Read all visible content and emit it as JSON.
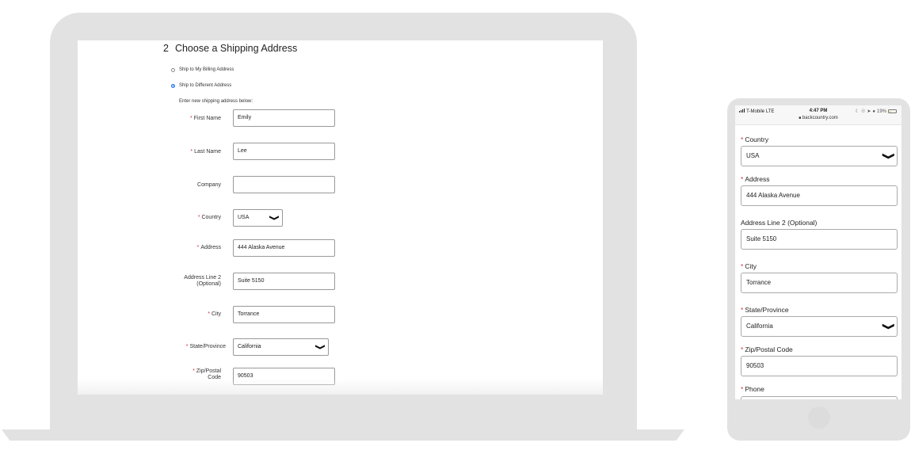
{
  "desktop": {
    "section_step": "2",
    "section_title": "Choose a Shipping Address",
    "shipping_options": [
      {
        "label": "Ship to My Billing Address",
        "checked": false
      },
      {
        "label": "Ship to Different Address",
        "checked": true
      }
    ],
    "hint": "Enter new shipping address below:",
    "required_marker": "*",
    "fields": {
      "first_name": {
        "label": "First Name",
        "value": "Emily",
        "required": true
      },
      "last_name": {
        "label": "Last Name",
        "value": "Lee",
        "required": true
      },
      "company": {
        "label": "Company",
        "value": "",
        "required": false
      },
      "country": {
        "label": "Country",
        "value": "USA",
        "required": true
      },
      "address": {
        "label": "Address",
        "value": "444 Alaska Avenue",
        "required": true
      },
      "address2": {
        "label_line1": "Address Line 2",
        "label_line2": "(Optional)",
        "value": "Suite 5150",
        "required": false
      },
      "city": {
        "label": "City",
        "value": "Torrance",
        "required": true
      },
      "state": {
        "label": "State/Province",
        "value": "California",
        "required": true
      },
      "zip": {
        "label_line1": "Zip/Postal",
        "label_line2": "Code",
        "value": "90503",
        "required": true
      }
    }
  },
  "mobile": {
    "status_bar": {
      "carrier": "T-Mobile  LTE",
      "time": "4:47 PM",
      "url": "backcountry.com",
      "battery": "19%",
      "battery_level": 0.19
    },
    "required_marker": "*",
    "fields": {
      "country": {
        "label": "Country",
        "value": "USA"
      },
      "address": {
        "label": "Address",
        "value": "444 Alaska Avenue"
      },
      "address2": {
        "label": "Address Line 2 (Optional)",
        "value": "Suite 5150"
      },
      "city": {
        "label": "City",
        "value": "Torrance"
      },
      "state": {
        "label": "State/Province",
        "value": "California"
      },
      "zip": {
        "label": "Zip/Postal Code",
        "value": "90503"
      },
      "phone": {
        "label": "Phone",
        "value": ""
      }
    }
  },
  "icons": {
    "chevron_down": "❯",
    "lock": "🔒"
  }
}
